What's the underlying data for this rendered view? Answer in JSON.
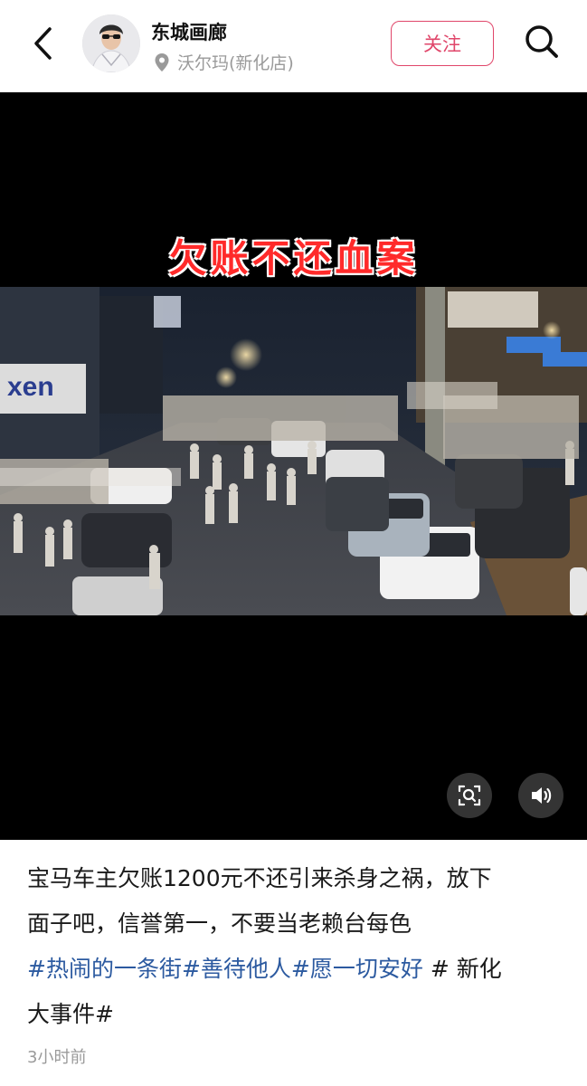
{
  "header": {
    "author_name": "东城画廊",
    "location": "沃尔玛(新化店)",
    "follow_label": "关注"
  },
  "video": {
    "overlay_title": "欠账不还血案",
    "sign_text": "xen"
  },
  "post": {
    "text_line1": "宝马车主欠账1200元不还引来杀身之祸，放下",
    "text_line2": "面子吧，信誉第一，不要当老赖台每色",
    "tags": [
      "#热闹的一条街",
      "#善待他人",
      "#愿一切安好",
      "# 新化",
      "大事件#"
    ],
    "time": "3小时前"
  },
  "colors": {
    "accent": "#e0466a",
    "tag": "#2c5aa0",
    "overlay_title": "#ff2a2a"
  },
  "icons": {
    "back": "chevron-left-icon",
    "search": "search-icon",
    "location": "location-pin-icon",
    "screenshot": "screenshot-icon",
    "volume": "volume-icon"
  }
}
